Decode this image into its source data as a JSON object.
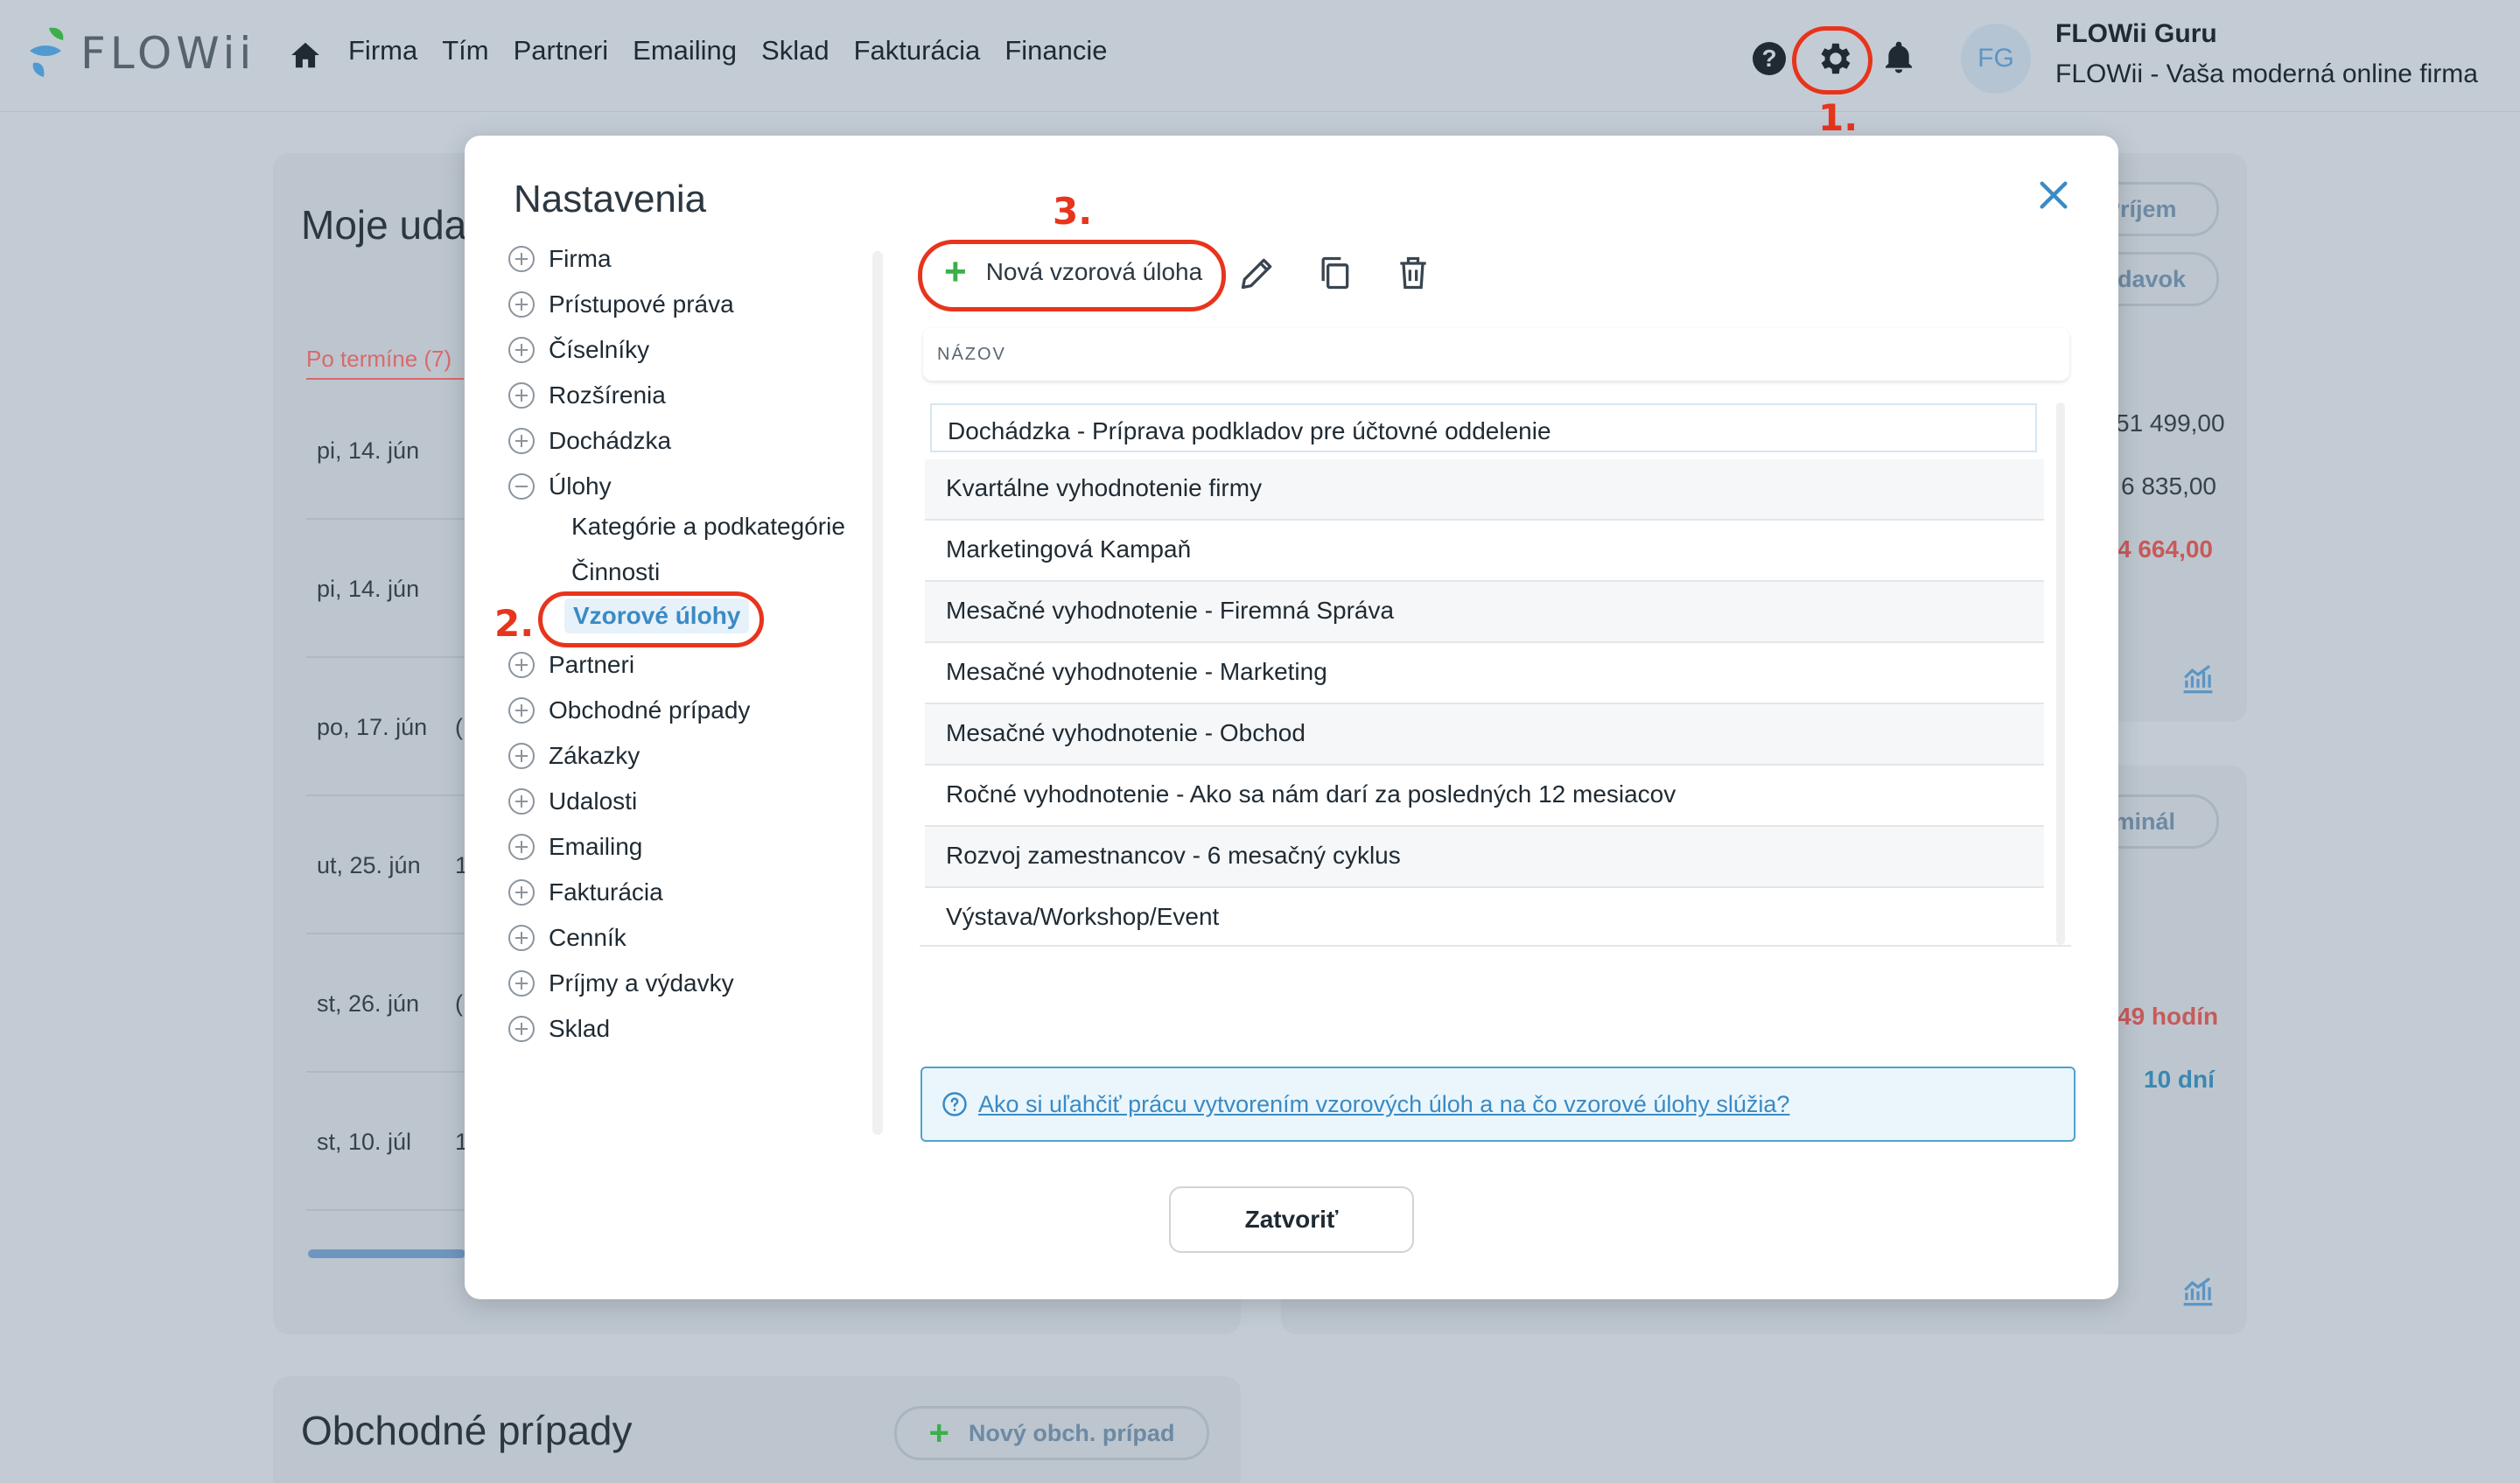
{
  "brand": {
    "name": "FLOWii"
  },
  "nav": {
    "items": [
      "Firma",
      "Tím",
      "Partneri",
      "Emailing",
      "Sklad",
      "Fakturácia",
      "Financie"
    ]
  },
  "user": {
    "initials": "FG",
    "name": "FLOWii Guru",
    "company": "FLOWii - Vaša moderná online firma"
  },
  "header_icons": {
    "help": "?"
  },
  "annotations": {
    "step1": "1.",
    "step2": "2.",
    "step3": "3."
  },
  "background": {
    "card1_title": "Moje uda",
    "card1_tab": "Po termíne (7)",
    "dates": [
      "pi, 14. jún",
      "pi, 14. jún",
      "po, 17. jún",
      "ut, 25. jún",
      "st, 26. jún",
      "st, 10. júl"
    ],
    "date_suffix": [
      "",
      "",
      "(",
      "1",
      "(",
      "1"
    ],
    "pill_prijem": "Príjem",
    "pill_vydavok": "ýdavok",
    "num1": "51 499,00",
    "num2": "6 835,00",
    "num3": "4 664,00",
    "pill_terminal": "rminál",
    "hours": "49 hodín",
    "days": "10 dní",
    "card3_title": "Obchodné prípady",
    "new_case_button": "Nový obch. prípad"
  },
  "modal": {
    "title": "Nastavenia",
    "tree": [
      "Firma",
      "Prístupové práva",
      "Číselníky",
      "Rozšírenia",
      "Dochádzka",
      "Úlohy"
    ],
    "tree_sub": [
      "Kategórie a podkategórie",
      "Činnosti",
      "Vzorové úlohy"
    ],
    "tree_after": [
      "Partneri",
      "Obchodné prípady",
      "Zákazky",
      "Udalosti",
      "Emailing",
      "Fakturácia",
      "Cenník",
      "Príjmy a výdavky",
      "Sklad"
    ],
    "new_button": "Nová vzorová úloha",
    "table_header": "NÁZOV",
    "rows": [
      "Dochádzka - Príprava podkladov pre účtovné oddelenie",
      "Kvartálne vyhodnotenie firmy",
      "Marketingová Kampaň",
      "Mesačné vyhodnotenie - Firemná Správa",
      "Mesačné vyhodnotenie - Marketing",
      "Mesačné vyhodnotenie - Obchod",
      "Ročné vyhodnotenie - Ako sa nám darí za posledných 12 mesiacov",
      "Rozvoj zamestnancov - 6 mesačný cyklus",
      "Výstava/Workshop/Event"
    ],
    "info_link": "Ako si uľahčiť prácu vytvorením vzorových úloh a na čo vzorové úlohy slúžia?",
    "close_button": "Zatvoriť"
  }
}
